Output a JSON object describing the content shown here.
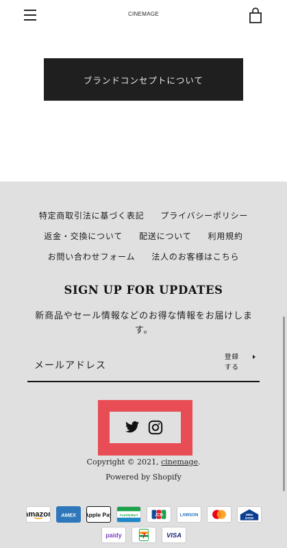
{
  "header": {
    "logo_text": "CINEMAGE",
    "menu_icon": "hamburger-menu-icon",
    "cart_icon": "shopping-bag-icon"
  },
  "main": {
    "concept_button_label": "ブランドコンセプトについて"
  },
  "footer": {
    "links_row1": [
      "特定商取引法に基づく表記",
      "プライバシーポリシー"
    ],
    "links_row2": [
      "返金・交換について",
      "配送について",
      "利用規約"
    ],
    "links_row3": [
      "お問い合わせフォーム",
      "法人のお客様はこちら"
    ],
    "signup_title": "SIGN UP FOR UPDATES",
    "signup_description": "新商品やセール情報などのお得な情報をお届けします。",
    "email_placeholder": "メールアドレス",
    "register_label_line1": "登録",
    "register_label_line2": "する",
    "social_icons": [
      "twitter-icon",
      "instagram-icon"
    ],
    "copyright_prefix": "Copyright © 2021, ",
    "copyright_link": "cinemage",
    "copyright_suffix": ".",
    "powered_by": "Powered by Shopify",
    "payments_row1": [
      "amazon",
      "AMEX",
      "Apple Pay",
      "FamilyMart",
      "JCB",
      "LAWSON",
      "mastercard",
      "MINI STOP"
    ],
    "payments_row2": [
      "paidy",
      "7-Eleven",
      "VISA"
    ],
    "highlight_color": "#e84c55",
    "background_color": "#e0e0e0"
  }
}
